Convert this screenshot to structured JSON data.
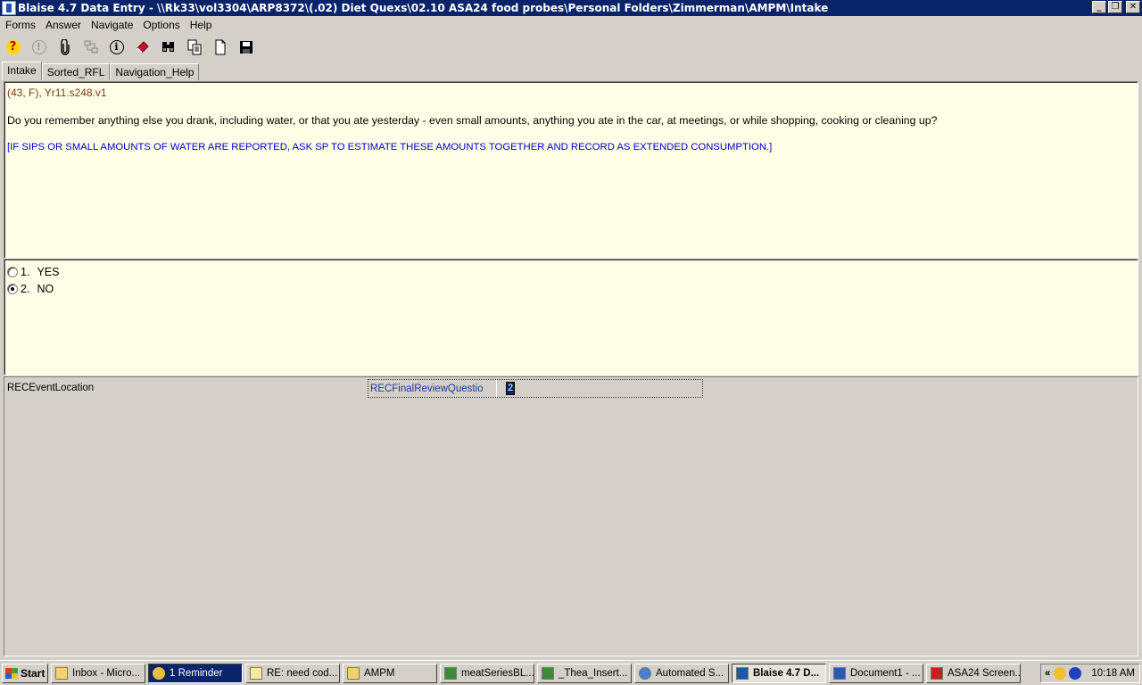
{
  "window": {
    "title": "Blaise 4.7 Data Entry - \\\\Rk33\\vol3304\\ARP8372\\(.02) Diet Quexs\\02.10 ASA24 food probes\\Personal Folders\\Zimmerman\\AMPM\\Intake",
    "minimize": "_",
    "restore": "❐",
    "close": "✕"
  },
  "menu": [
    "Forms",
    "Answer",
    "Navigate",
    "Options",
    "Help"
  ],
  "toolbar": {
    "help_icon": "?",
    "warning_icon": "!",
    "info_icon": "i"
  },
  "tabs": [
    "Intake",
    "Sorted_RFL",
    "Navigation_Help"
  ],
  "question": {
    "id": "(43, F),   Yr11.s248.v1",
    "text": "Do you remember anything else you drank, including water, or that you ate yesterday - even small amounts, anything you ate in the car, at meetings, or while shopping, cooking or cleaning up?",
    "instruction": "[IF SIPS OR SMALL AMOUNTS OF WATER ARE REPORTED, ASK SP TO ESTIMATE THESE AMOUNTS TOGETHER AND RECORD AS EXTENDED CONSUMPTION.]"
  },
  "answers": [
    {
      "code": "1.",
      "label": "YES",
      "checked": false
    },
    {
      "code": "2.",
      "label": "NO",
      "checked": true
    }
  ],
  "fields": {
    "left_label": "RECEventLocation",
    "field_name": "RECFinalReviewQuestio",
    "field_value": "2"
  },
  "taskbar": {
    "start": "Start",
    "items": [
      {
        "label": "Inbox - Micro...",
        "state": "normal"
      },
      {
        "label": "1 Reminder",
        "state": "dark"
      },
      {
        "label": "RE: need cod...",
        "state": "normal"
      },
      {
        "label": "AMPM",
        "state": "normal"
      },
      {
        "label": "meatSeriesBL...",
        "state": "normal"
      },
      {
        "label": "_Thea_Insert...",
        "state": "normal"
      },
      {
        "label": "Automated S...",
        "state": "normal"
      },
      {
        "label": "Blaise 4.7 D...",
        "state": "pressed"
      },
      {
        "label": "Document1 - ...",
        "state": "normal"
      },
      {
        "label": "ASA24 Screen...",
        "state": "normal"
      }
    ],
    "tray_chevron": "«",
    "clock": "10:18 AM"
  }
}
